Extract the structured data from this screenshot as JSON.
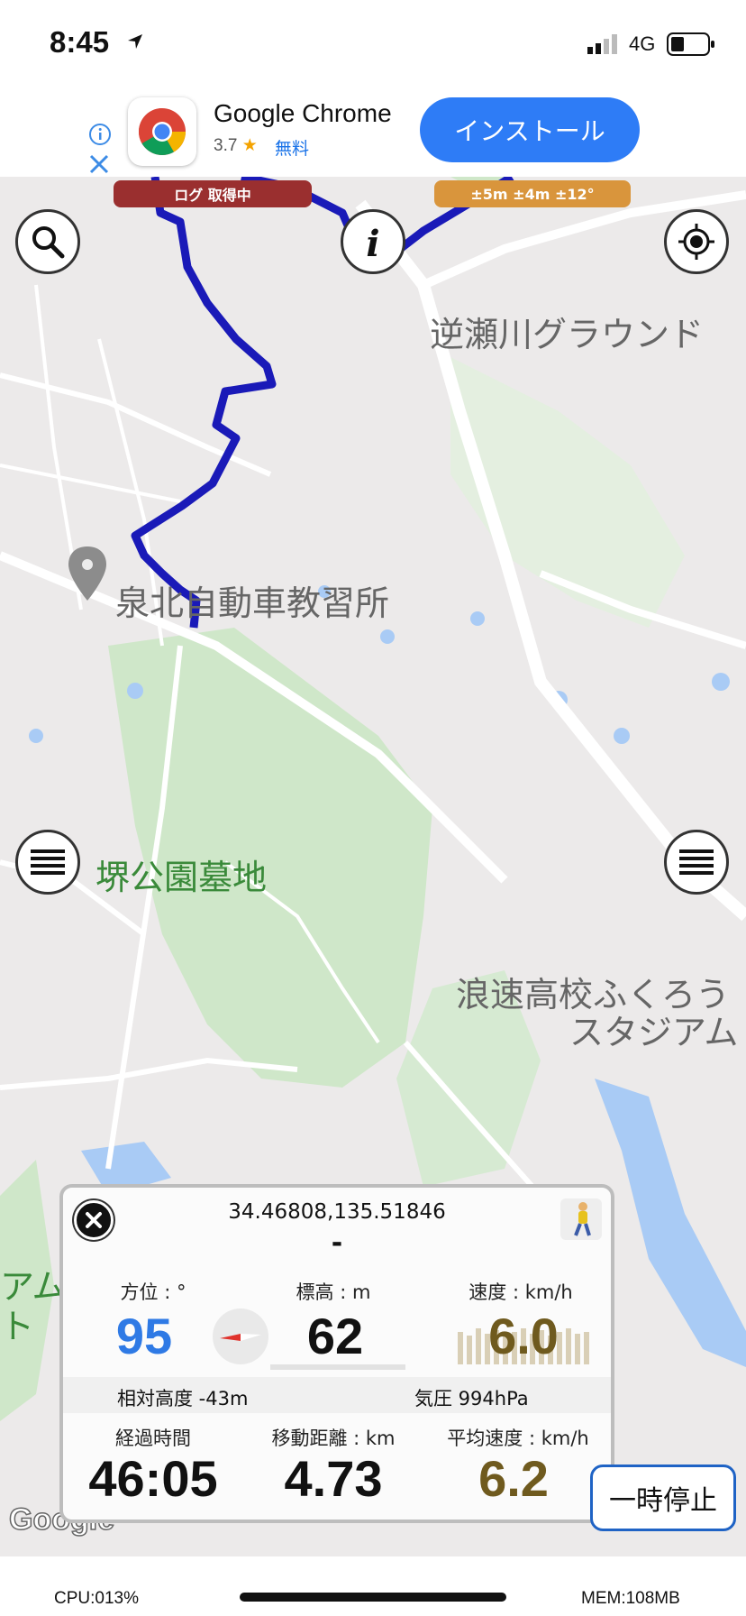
{
  "status_bar": {
    "time": "8:45",
    "network": "4G"
  },
  "ad": {
    "app_name": "Google Chrome",
    "rating": "3.7",
    "price": "無料",
    "install_label": "インストール"
  },
  "map": {
    "log_status": "ログ 取得中",
    "accuracy": "±5m ±4m ±12°",
    "places": {
      "ground": "逆瀬川グラウンド",
      "driving_school": "泉北自動車教習所",
      "cemetery": "堺公園墓地",
      "stadium_line1": "浪速高校ふくろう",
      "stadium_line2": "スタジアム",
      "partial_left_1": "アム",
      "partial_left_2": "ト"
    },
    "attribution": "Google"
  },
  "panel": {
    "coordinates": "34.46808,135.51846",
    "address": "-",
    "bearing_label": "方位 : °",
    "bearing_value": "95",
    "elevation_label": "標高 : m",
    "elevation_value": "62",
    "speed_label": "速度 : km/h",
    "speed_value": "6.0",
    "relative_altitude": "相対高度 -43m",
    "pressure": "気圧 994hPa",
    "elapsed_label": "経過時間",
    "elapsed_value": "46:05",
    "distance_label": "移動距離 : km",
    "distance_value": "4.73",
    "avg_speed_label": "平均速度 : km/h",
    "avg_speed_value": "6.2"
  },
  "pause_label": "一時停止",
  "system": {
    "cpu": "CPU:013%",
    "mem": "MEM:108MB"
  },
  "colors": {
    "route": "#1a1ab8",
    "bearing_value": "#2f7ae5",
    "speed_value": "#6f5a1e",
    "ad_button": "#2e7cf6",
    "log_pill": "#9a2f2f",
    "accuracy_pill": "#d9953c"
  }
}
